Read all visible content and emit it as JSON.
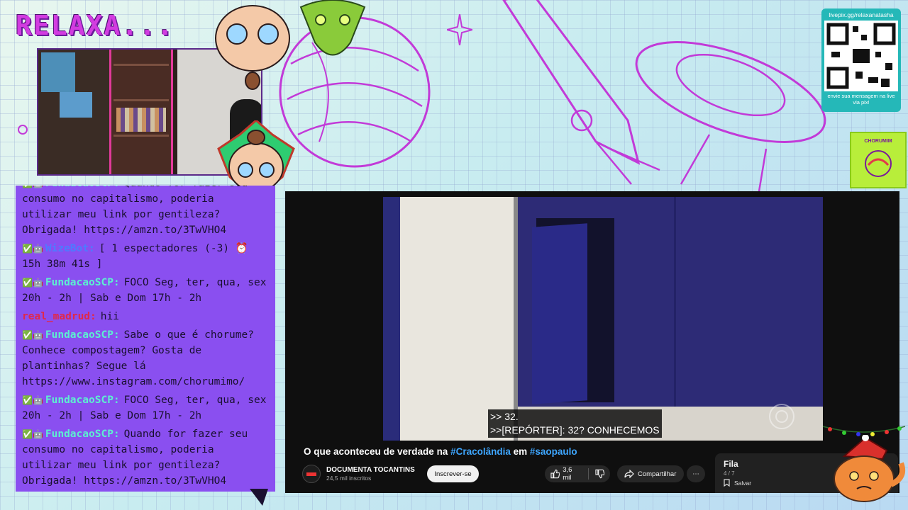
{
  "overlay": {
    "logo_text": "RELAXA...",
    "qr": {
      "url": "livepix.gg/relaxanatasha",
      "message": "envie sua mensagem na live via pix!"
    },
    "green_badge_text": "CHORUMIM"
  },
  "chat": {
    "messages": [
      {
        "user": "FundacaoSCP:",
        "user_color": "#5cf0d0",
        "text": "Quando for fazer seu consumo no capitalismo, poderia utilizar meu link por gentileza? Obrigada! https://amzn.to/3TwVHO4",
        "cut_top": true
      },
      {
        "user": "WizeBot:",
        "user_color": "#4d7bff",
        "text": "[ 1 espectadores (-3) ⏰ 15h 38m 41s ]"
      },
      {
        "user": "FundacaoSCP:",
        "user_color": "#5cf0d0",
        "text": "FOCO Seg, ter, qua, sex 20h - 2h | Sab e Dom 17h - 2h"
      },
      {
        "user": "real_madrud:",
        "user_color": "#e0294a",
        "text": "hii"
      },
      {
        "user": "FundacaoSCP:",
        "user_color": "#5cf0d0",
        "text": "Sabe o que é chorume? Conhece compostagem? Gosta de plantinhas? Segue lá https://www.instagram.com/chorumimo/"
      },
      {
        "user": "FundacaoSCP:",
        "user_color": "#5cf0d0",
        "text": "FOCO Seg, ter, qua, sex 20h - 2h | Sab e Dom 17h - 2h"
      },
      {
        "user": "FundacaoSCP:",
        "user_color": "#5cf0d0",
        "text": "Quando for fazer seu consumo no capitalismo, poderia utilizar meu link por gentileza? Obrigada! https://amzn.to/3TwVHO4"
      }
    ]
  },
  "video": {
    "subtitle_line1": ">> 32.",
    "subtitle_line2": ">>[REPÓRTER]: 32? CONHECEMOS",
    "title_prefix": "O que aconteceu de verdade na ",
    "title_tag1": "#Cracolândia",
    "title_middle": " em ",
    "title_tag2": "#saopaulo",
    "channel_name": "DOCUMENTA TOCANTINS",
    "channel_subs": "24,5 mil inscritos",
    "subscribe_label": "Inscrever-se",
    "likes": "3,6 mil",
    "share_label": "Compartilhar",
    "more_label": "⋯"
  },
  "queue": {
    "title": "Fila",
    "count": "4 / 7",
    "save_label": "Salvar"
  },
  "colors": {
    "chat_bg": "#8a4ff0",
    "logo": "#d23ce0",
    "link_blue": "#3ea6ff"
  }
}
